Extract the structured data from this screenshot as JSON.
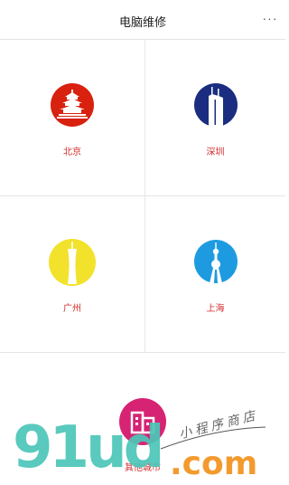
{
  "navbar": {
    "title": "电脑维修",
    "more": "···"
  },
  "cities": [
    {
      "label": "北京",
      "icon": "temple-of-heaven-icon",
      "color": "#d8210f"
    },
    {
      "label": "深圳",
      "icon": "skyscraper-icon",
      "color": "#1a2d80"
    },
    {
      "label": "广州",
      "icon": "canton-tower-icon",
      "color": "#f2e22b"
    },
    {
      "label": "上海",
      "icon": "oriental-pearl-tower-icon",
      "color": "#1e9be0"
    },
    {
      "label": "其他城市",
      "icon": "buildings-icon",
      "color": "#d62374"
    }
  ],
  "watermark": {
    "number": "91ud",
    "domain": ".com",
    "tagline": "小程序商店"
  },
  "colors": {
    "label_red": "#d42a2a",
    "divider": "#e6e6e6"
  }
}
